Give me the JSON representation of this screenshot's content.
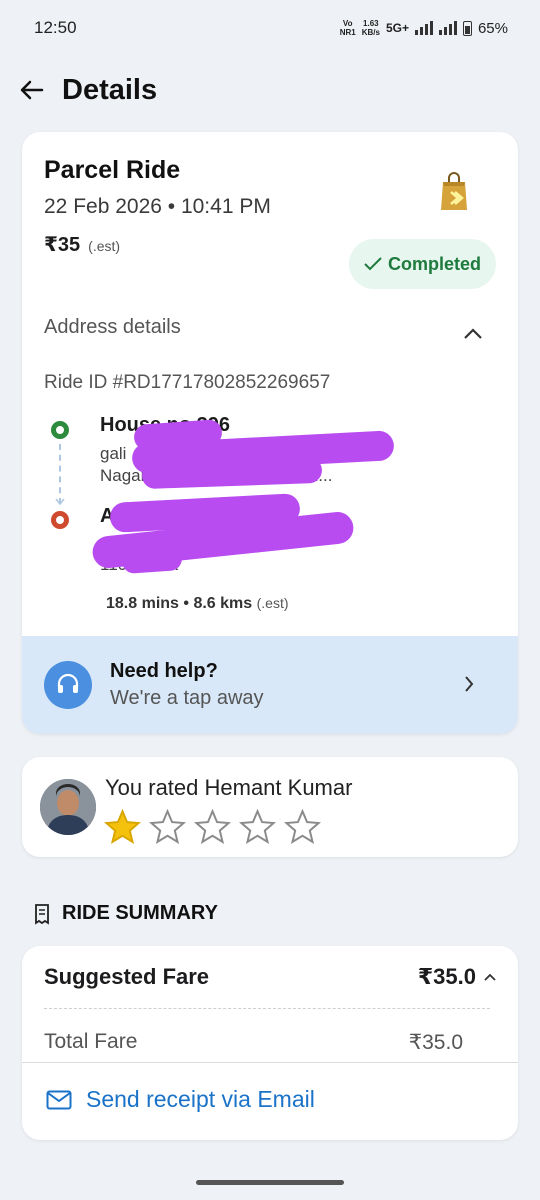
{
  "status": {
    "time": "12:50",
    "network_label_top": "Vo",
    "network_label_bot": "NR1",
    "speed_top": "1.63",
    "speed_bot": "KB/s",
    "net_type": "5G+",
    "battery": "65%"
  },
  "header": {
    "title": "Details"
  },
  "ride": {
    "type": "Parcel Ride",
    "datetime": "22 Feb 2026 • 10:41 PM",
    "fare": "₹35",
    "fare_note": "(.est)",
    "status": "Completed",
    "address_heading": "Address details",
    "ride_id": "Ride ID #RD17717802852269657",
    "pickup": {
      "title": "House no 396",
      "line1": "gali ... Poonga",
      "line2": "Nagar, ... New Delhi, Delhi, 1..."
    },
    "drop": {
      "title": "A... near savej dairy",
      "line1": "... abad, Delhi,",
      "line2": "110... ndia"
    },
    "duration": "18.8 mins",
    "distance": "8.6 kms",
    "trip_est": "(.est)"
  },
  "help": {
    "title": "Need help?",
    "subtitle": "We're a tap away"
  },
  "rating": {
    "text": "You rated Hemant Kumar",
    "stars": 1,
    "max_stars": 5
  },
  "summary": {
    "heading": "RIDE SUMMARY",
    "suggested_label": "Suggested Fare",
    "suggested_value": "₹35.0",
    "total_label": "Total Fare",
    "total_value": "₹35.0",
    "send_receipt": "Send receipt via Email"
  },
  "colors": {
    "accent_blue": "#1a73c8",
    "success_green": "#1f7a3d",
    "pickup_green": "#2e8b3e",
    "drop_red": "#d04a2f",
    "star_gold": "#f4c20d",
    "redaction_purple": "#b94cf0"
  }
}
